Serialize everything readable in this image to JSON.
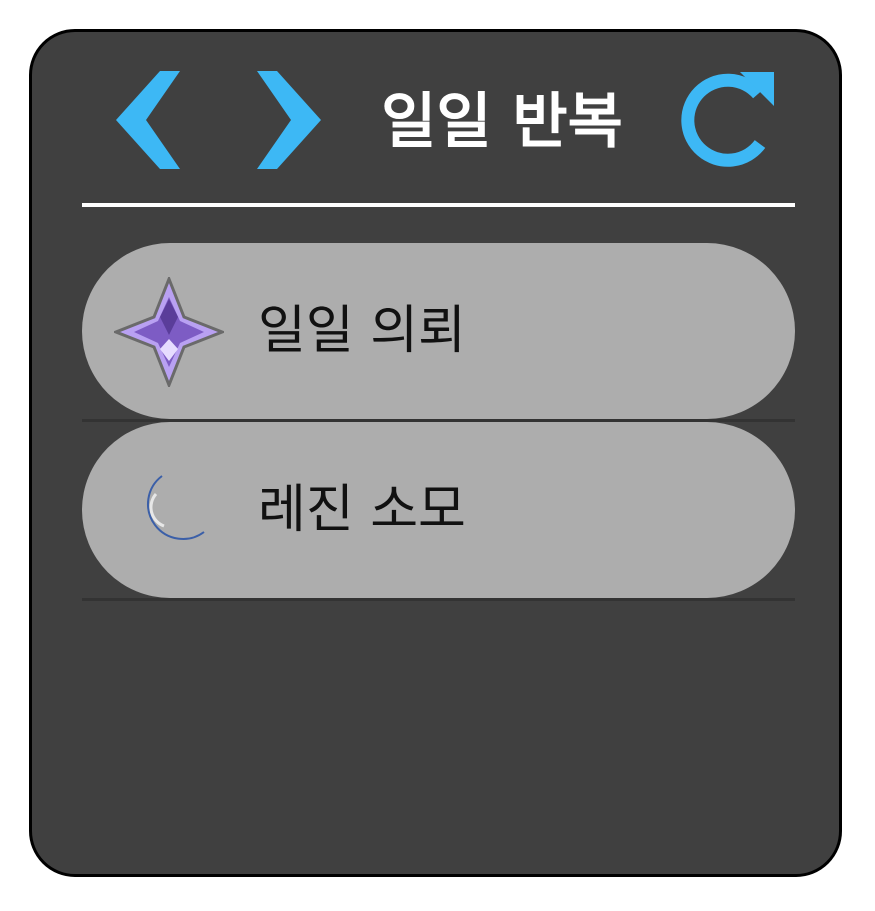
{
  "header": {
    "title": "일일 반복",
    "prev_icon": "chevron-left-icon",
    "next_icon": "chevron-right-icon",
    "refresh_icon": "refresh-icon",
    "accent_color": "#3db8f5"
  },
  "items": [
    {
      "label": "일일 의뢰",
      "icon": "star-icon"
    },
    {
      "label": "레진 소모",
      "icon": "crescent-moon-icon"
    }
  ],
  "colors": {
    "panel_bg": "#404040",
    "item_bg": "#adadad",
    "title_text": "#ffffff"
  }
}
